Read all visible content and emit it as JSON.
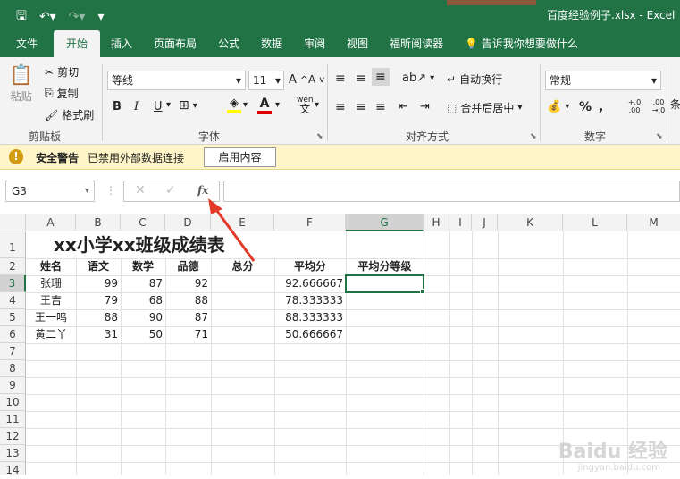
{
  "window": {
    "title": "百度经验例子.xlsx - Excel"
  },
  "tabs": [
    {
      "label": "文件"
    },
    {
      "label": "开始"
    },
    {
      "label": "插入"
    },
    {
      "label": "页面布局"
    },
    {
      "label": "公式"
    },
    {
      "label": "数据"
    },
    {
      "label": "审阅"
    },
    {
      "label": "视图"
    },
    {
      "label": "福昕阅读器"
    },
    {
      "label": "告诉我你想要做什么"
    }
  ],
  "ribbon": {
    "paste": "粘贴",
    "cut": "剪切",
    "copy": "复制",
    "format_painter": "格式刷",
    "clipboard_label": "剪贴板",
    "font_name": "等线",
    "font_size": "11",
    "bold": "B",
    "italic": "I",
    "underline": "U",
    "phonetic": "wén",
    "font_label": "字体",
    "wrap_text": "自动换行",
    "merge_center": "合并后居中",
    "align_label": "对齐方式",
    "number_format": "常规",
    "percent": "%",
    "dec_inc": "+.0 .00",
    "dec_dec": ".00 →.0",
    "number_label": "数字",
    "cond_format": "条"
  },
  "message_bar": {
    "title": "安全警告",
    "text": "已禁用外部数据连接",
    "button": "启用内容"
  },
  "formula_bar": {
    "name_box": "G3",
    "fx": "fx",
    "formula": ""
  },
  "columns": [
    "A",
    "B",
    "C",
    "D",
    "E",
    "F",
    "G",
    "H",
    "I",
    "J",
    "K",
    "L",
    "M"
  ],
  "rows": [
    "1",
    "2",
    "3",
    "4",
    "5",
    "6",
    "7",
    "8",
    "9",
    "10",
    "11",
    "12",
    "13",
    "14"
  ],
  "sheet": {
    "title": "xx小学xx班级成绩表",
    "headers": [
      "姓名",
      "语文",
      "数学",
      "品德",
      "总分",
      "平均分",
      "平均分等级"
    ],
    "data": [
      {
        "name": "张珊",
        "chinese": "99",
        "math": "87",
        "morality": "92",
        "avg": "92.666667"
      },
      {
        "name": "王吉",
        "chinese": "79",
        "math": "68",
        "morality": "88",
        "avg": "78.333333"
      },
      {
        "name": "王一鸣",
        "chinese": "88",
        "math": "90",
        "morality": "87",
        "avg": "88.333333"
      },
      {
        "name": "黄二丫",
        "chinese": "31",
        "math": "50",
        "morality": "71",
        "avg": "50.666667"
      }
    ]
  },
  "watermark": {
    "text": "Baidu 经验",
    "sub": "jingyan.baidu.com"
  },
  "colors": {
    "excel_green": "#217346",
    "arrow_red": "#e23b2a"
  }
}
